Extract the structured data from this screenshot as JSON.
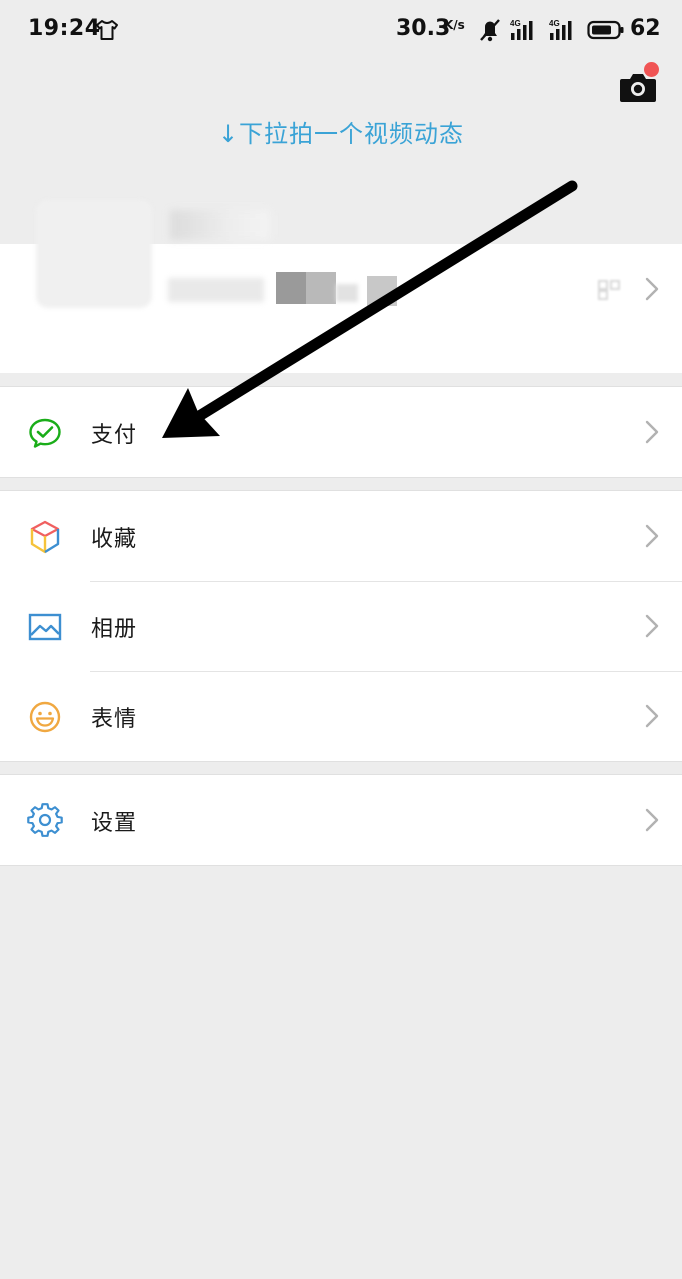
{
  "status_bar": {
    "time": "19:24",
    "speed": "30.3",
    "speed_unit": "K/s",
    "battery": "62"
  },
  "top": {
    "pull_hint": "↓下拉拍一个视频动态",
    "camera_icon": "camera-icon"
  },
  "menu": {
    "pay": {
      "label": "支付",
      "icon": "wechat-pay-icon",
      "color": "#1aad19"
    },
    "favorites": {
      "label": "收藏",
      "icon": "cube-icon"
    },
    "album": {
      "label": "相册",
      "icon": "picture-icon",
      "color": "#3d8fd1"
    },
    "stickers": {
      "label": "表情",
      "icon": "smiley-icon",
      "color": "#f0a841"
    },
    "settings": {
      "label": "设置",
      "icon": "gear-icon",
      "color": "#3d8fd1"
    }
  },
  "colors": {
    "background": "#ededed",
    "accent_text": "#3aa3d6",
    "notification_dot": "#f05454"
  }
}
